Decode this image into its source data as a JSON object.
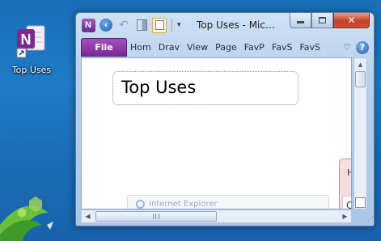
{
  "desktop": {
    "icon_label": "Top Uses",
    "icon_name": "onenote-shortcut-icon"
  },
  "window": {
    "title": "Top Uses  -  Mic…",
    "app_logo": "N",
    "caption_buttons": [
      "minimize",
      "maximize",
      "close"
    ],
    "close_glyph": "✕"
  },
  "ribbon": {
    "file_tab": "File",
    "tabs": [
      "Hom",
      "Drav",
      "View",
      "Page",
      "FavP",
      "FavS",
      "FavS"
    ]
  },
  "page": {
    "title": "Top Uses",
    "panel_letter_1": "H",
    "panel_letter_2": "C",
    "ie_snippet": "Internet Explorer"
  },
  "colors": {
    "onenote_purple": "#7a2a93",
    "close_red": "#c4412a"
  }
}
